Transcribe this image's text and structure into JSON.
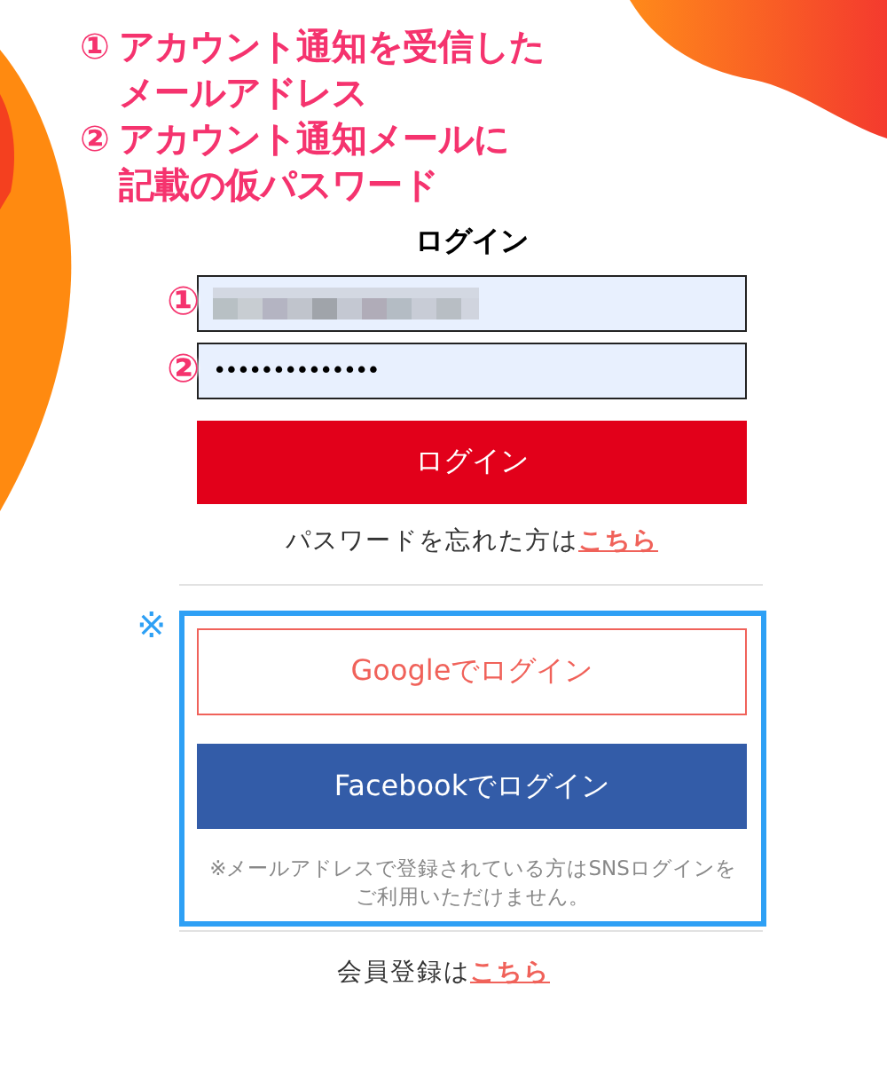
{
  "annotations": [
    {
      "marker": "①",
      "lines": [
        "アカウント通知を受信した",
        "メールアドレス"
      ]
    },
    {
      "marker": "②",
      "lines": [
        "アカウント通知メールに",
        "記載の仮パスワード"
      ]
    }
  ],
  "title": "ログイン",
  "email_field": {
    "marker": "①"
  },
  "password_field": {
    "marker": "②",
    "value": "••••••••••••••"
  },
  "login_button": "ログイン",
  "forgot": {
    "text": "パスワードを忘れた方は",
    "link": "こちら"
  },
  "sns_note_mark": "※",
  "sns_buttons": [
    {
      "kind": "google",
      "label": "Googleでログイン"
    },
    {
      "kind": "facebook",
      "label": "Facebookでログイン"
    }
  ],
  "sns_note": "※メールアドレスで登録されている方はSNSログインをご利用いただけません。",
  "register": {
    "text": "会員登録は",
    "link": "こちら"
  }
}
